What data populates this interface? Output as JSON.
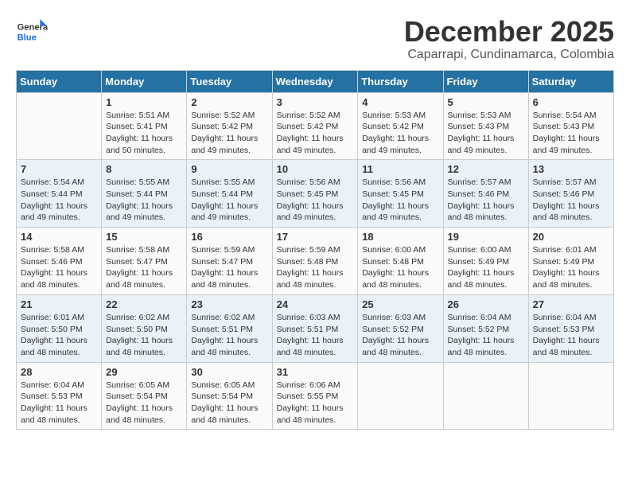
{
  "header": {
    "logo_general": "General",
    "logo_blue": "Blue",
    "title": "December 2025",
    "subtitle": "Caparrapi, Cundinamarca, Colombia"
  },
  "weekdays": [
    "Sunday",
    "Monday",
    "Tuesday",
    "Wednesday",
    "Thursday",
    "Friday",
    "Saturday"
  ],
  "weeks": [
    [
      {
        "day": "",
        "sunrise": "",
        "sunset": "",
        "daylight": ""
      },
      {
        "day": "1",
        "sunrise": "Sunrise: 5:51 AM",
        "sunset": "Sunset: 5:41 PM",
        "daylight": "Daylight: 11 hours and 50 minutes."
      },
      {
        "day": "2",
        "sunrise": "Sunrise: 5:52 AM",
        "sunset": "Sunset: 5:42 PM",
        "daylight": "Daylight: 11 hours and 49 minutes."
      },
      {
        "day": "3",
        "sunrise": "Sunrise: 5:52 AM",
        "sunset": "Sunset: 5:42 PM",
        "daylight": "Daylight: 11 hours and 49 minutes."
      },
      {
        "day": "4",
        "sunrise": "Sunrise: 5:53 AM",
        "sunset": "Sunset: 5:42 PM",
        "daylight": "Daylight: 11 hours and 49 minutes."
      },
      {
        "day": "5",
        "sunrise": "Sunrise: 5:53 AM",
        "sunset": "Sunset: 5:43 PM",
        "daylight": "Daylight: 11 hours and 49 minutes."
      },
      {
        "day": "6",
        "sunrise": "Sunrise: 5:54 AM",
        "sunset": "Sunset: 5:43 PM",
        "daylight": "Daylight: 11 hours and 49 minutes."
      }
    ],
    [
      {
        "day": "7",
        "sunrise": "Sunrise: 5:54 AM",
        "sunset": "Sunset: 5:44 PM",
        "daylight": "Daylight: 11 hours and 49 minutes."
      },
      {
        "day": "8",
        "sunrise": "Sunrise: 5:55 AM",
        "sunset": "Sunset: 5:44 PM",
        "daylight": "Daylight: 11 hours and 49 minutes."
      },
      {
        "day": "9",
        "sunrise": "Sunrise: 5:55 AM",
        "sunset": "Sunset: 5:44 PM",
        "daylight": "Daylight: 11 hours and 49 minutes."
      },
      {
        "day": "10",
        "sunrise": "Sunrise: 5:56 AM",
        "sunset": "Sunset: 5:45 PM",
        "daylight": "Daylight: 11 hours and 49 minutes."
      },
      {
        "day": "11",
        "sunrise": "Sunrise: 5:56 AM",
        "sunset": "Sunset: 5:45 PM",
        "daylight": "Daylight: 11 hours and 49 minutes."
      },
      {
        "day": "12",
        "sunrise": "Sunrise: 5:57 AM",
        "sunset": "Sunset: 5:46 PM",
        "daylight": "Daylight: 11 hours and 48 minutes."
      },
      {
        "day": "13",
        "sunrise": "Sunrise: 5:57 AM",
        "sunset": "Sunset: 5:46 PM",
        "daylight": "Daylight: 11 hours and 48 minutes."
      }
    ],
    [
      {
        "day": "14",
        "sunrise": "Sunrise: 5:58 AM",
        "sunset": "Sunset: 5:46 PM",
        "daylight": "Daylight: 11 hours and 48 minutes."
      },
      {
        "day": "15",
        "sunrise": "Sunrise: 5:58 AM",
        "sunset": "Sunset: 5:47 PM",
        "daylight": "Daylight: 11 hours and 48 minutes."
      },
      {
        "day": "16",
        "sunrise": "Sunrise: 5:59 AM",
        "sunset": "Sunset: 5:47 PM",
        "daylight": "Daylight: 11 hours and 48 minutes."
      },
      {
        "day": "17",
        "sunrise": "Sunrise: 5:59 AM",
        "sunset": "Sunset: 5:48 PM",
        "daylight": "Daylight: 11 hours and 48 minutes."
      },
      {
        "day": "18",
        "sunrise": "Sunrise: 6:00 AM",
        "sunset": "Sunset: 5:48 PM",
        "daylight": "Daylight: 11 hours and 48 minutes."
      },
      {
        "day": "19",
        "sunrise": "Sunrise: 6:00 AM",
        "sunset": "Sunset: 5:49 PM",
        "daylight": "Daylight: 11 hours and 48 minutes."
      },
      {
        "day": "20",
        "sunrise": "Sunrise: 6:01 AM",
        "sunset": "Sunset: 5:49 PM",
        "daylight": "Daylight: 11 hours and 48 minutes."
      }
    ],
    [
      {
        "day": "21",
        "sunrise": "Sunrise: 6:01 AM",
        "sunset": "Sunset: 5:50 PM",
        "daylight": "Daylight: 11 hours and 48 minutes."
      },
      {
        "day": "22",
        "sunrise": "Sunrise: 6:02 AM",
        "sunset": "Sunset: 5:50 PM",
        "daylight": "Daylight: 11 hours and 48 minutes."
      },
      {
        "day": "23",
        "sunrise": "Sunrise: 6:02 AM",
        "sunset": "Sunset: 5:51 PM",
        "daylight": "Daylight: 11 hours and 48 minutes."
      },
      {
        "day": "24",
        "sunrise": "Sunrise: 6:03 AM",
        "sunset": "Sunset: 5:51 PM",
        "daylight": "Daylight: 11 hours and 48 minutes."
      },
      {
        "day": "25",
        "sunrise": "Sunrise: 6:03 AM",
        "sunset": "Sunset: 5:52 PM",
        "daylight": "Daylight: 11 hours and 48 minutes."
      },
      {
        "day": "26",
        "sunrise": "Sunrise: 6:04 AM",
        "sunset": "Sunset: 5:52 PM",
        "daylight": "Daylight: 11 hours and 48 minutes."
      },
      {
        "day": "27",
        "sunrise": "Sunrise: 6:04 AM",
        "sunset": "Sunset: 5:53 PM",
        "daylight": "Daylight: 11 hours and 48 minutes."
      }
    ],
    [
      {
        "day": "28",
        "sunrise": "Sunrise: 6:04 AM",
        "sunset": "Sunset: 5:53 PM",
        "daylight": "Daylight: 11 hours and 48 minutes."
      },
      {
        "day": "29",
        "sunrise": "Sunrise: 6:05 AM",
        "sunset": "Sunset: 5:54 PM",
        "daylight": "Daylight: 11 hours and 48 minutes."
      },
      {
        "day": "30",
        "sunrise": "Sunrise: 6:05 AM",
        "sunset": "Sunset: 5:54 PM",
        "daylight": "Daylight: 11 hours and 48 minutes."
      },
      {
        "day": "31",
        "sunrise": "Sunrise: 6:06 AM",
        "sunset": "Sunset: 5:55 PM",
        "daylight": "Daylight: 11 hours and 48 minutes."
      },
      {
        "day": "",
        "sunrise": "",
        "sunset": "",
        "daylight": ""
      },
      {
        "day": "",
        "sunrise": "",
        "sunset": "",
        "daylight": ""
      },
      {
        "day": "",
        "sunrise": "",
        "sunset": "",
        "daylight": ""
      }
    ]
  ]
}
